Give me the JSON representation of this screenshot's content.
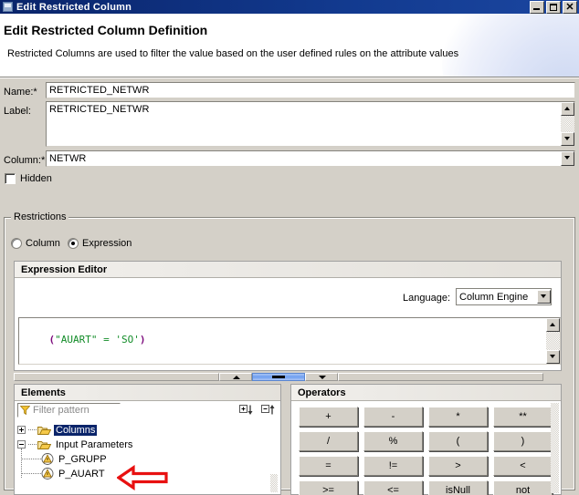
{
  "window": {
    "title": "Edit Restricted Column",
    "icon": "window-icon",
    "buttons": {
      "minimize": "–",
      "maximize": "□",
      "close": "✕"
    }
  },
  "header": {
    "title": "Edit Restricted Column Definition",
    "description": "Restricted Columns are used to filter the value based on the user defined rules on the attribute values"
  },
  "form": {
    "name": {
      "label": "Name:*",
      "value": "RETRICTED_NETWR"
    },
    "label": {
      "label": "Label:",
      "value": "RETRICTED_NETWR"
    },
    "column": {
      "label": "Column:*",
      "value": "NETWR"
    },
    "hidden": {
      "label": "Hidden",
      "checked": false
    }
  },
  "restrictions": {
    "title": "Restrictions",
    "options": [
      {
        "label": "Column",
        "selected": false
      },
      {
        "label": "Expression",
        "selected": true
      }
    ]
  },
  "expression_editor": {
    "title": "Expression Editor",
    "language_label": "Language:",
    "language_value": "Column Engine",
    "code_tokens": [
      {
        "text": "(",
        "kind": "paren"
      },
      {
        "text": "\"AUART\"",
        "kind": "string"
      },
      {
        "text": " = ",
        "kind": "op"
      },
      {
        "text": "'SO'",
        "kind": "string"
      },
      {
        "text": ")",
        "kind": "paren"
      }
    ],
    "code_plain": "(\"AUART\" = 'SO')"
  },
  "elements": {
    "title": "Elements",
    "filter_placeholder": "Filter pattern",
    "expand_all_icon": "expand-all-icon",
    "collapse_all_icon": "collapse-all-icon",
    "tree": [
      {
        "label": "Columns",
        "type": "folder",
        "expanded": false,
        "selected": true,
        "depth": 0
      },
      {
        "label": "Input Parameters",
        "type": "folder",
        "expanded": true,
        "selected": false,
        "depth": 0
      },
      {
        "label": "P_GRUPP",
        "type": "parameter",
        "selected": false,
        "depth": 1
      },
      {
        "label": "P_AUART",
        "type": "parameter",
        "selected": false,
        "depth": 1
      }
    ]
  },
  "operators": {
    "title": "Operators",
    "buttons": [
      "+",
      "-",
      "*",
      "**",
      "/",
      "%",
      "(",
      ")",
      "=",
      "!=",
      ">",
      "<",
      ">=",
      "<=",
      "isNull",
      "not"
    ]
  },
  "annotation": {
    "arrow": "red-left-arrow",
    "color": "#e81010",
    "points_at": "P_AUART"
  },
  "colors": {
    "titlebar": "#0a246a",
    "dialog_bg": "#d4d0c8",
    "selection": "#0a246a",
    "string_token": "#128c28",
    "paren_token": "#7c0a7c",
    "annotation": "#e81010"
  }
}
